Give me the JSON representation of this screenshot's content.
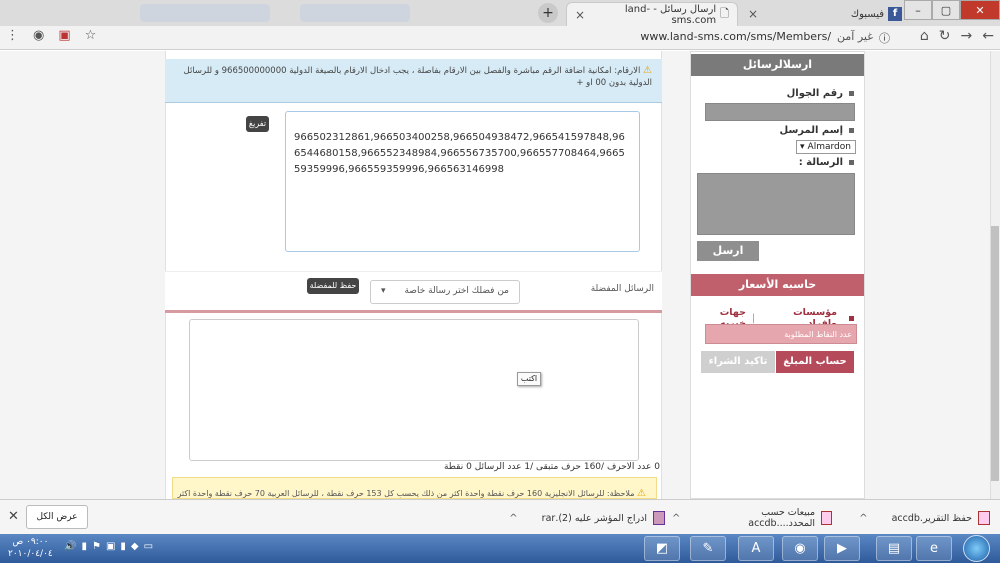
{
  "browser": {
    "tabs": [
      {
        "title": "ارسال رسائل - land-sms.com",
        "close": "×",
        "active": true
      },
      {
        "title": "فيسبوك",
        "close": "×",
        "active": false
      }
    ],
    "new_tab": "+",
    "address": {
      "url": "www.land-sms.com/sms/Members/",
      "security": "غير آمن"
    },
    "window_controls": [
      "–",
      "▢",
      "✕"
    ]
  },
  "page": {
    "numbers_hint": "الارقام: امكانية اضافة الرقم مباشرة والفصل بين الارقام بفاصلة ، يجب ادخال الارقام بالصيغة الدولية 966500000000 و للرسائل الدولية بدون 00 او +",
    "clear_label": "تفريغ",
    "numbers_value": "966502312861,966503400258,966504938472,966541597848,966544680158,966552348984,966556735700,966557708464,966559359996,966559359996,966563146998",
    "favorites_label": "الرسائل المفضلة",
    "favorites_select": "من فضلك اختر رسالة خاصة",
    "save_favorite": "حفظ للمفضلة",
    "write_button": "اكتب",
    "counter": "0 عدد الاحرف /160 حرف متبقى /1 عدد الرسائل 0 نقطة",
    "note": "ملاحظة: للرسائل الانجليزية 160 حرف نقطة واحدة اكثر من ذلك يحسب كل 153 حرف نقطة ، للرسائل العربية 70 حرف نقطة واحدة اكثر"
  },
  "sidebar": {
    "send_header": "ارسلالرسائل",
    "mobile_label": "رقم الجوال",
    "sender_label": "إسم المرسل",
    "sender_value": "Almardon",
    "message_label": "الرسالة :",
    "send_button": "ارسل",
    "calc_header": "حاسبه الأسعار",
    "link_individuals": "مؤسسات وافراد",
    "link_sep": "|",
    "link_charity": "جهات خيريه",
    "points_placeholder": "عدد النقاط المطلوبة",
    "calc_button": "حساب المبلغ",
    "confirm_button": "تاكيد الشراء"
  },
  "downloads": {
    "close": "✕",
    "show_all": "عرض الكل",
    "items": [
      {
        "name": "حفظ التقرير.accdb",
        "chevron": "^"
      },
      {
        "name": "مبيعات حسب المحدد....accdb",
        "chevron": "^"
      },
      {
        "name": "ادراج المؤشر عليه (2).rar",
        "chevron": "^"
      }
    ]
  },
  "taskbar": {
    "time": "٠٩:٠٠ ص",
    "date": "٢٠١٠/٠٤/٠٤"
  },
  "colors": {
    "send_header_bg": "#7a7a7a",
    "calc_header_bg": "#c0606d",
    "calc_button_bg": "#b54a5a",
    "info_bg": "#d7ebf6"
  }
}
